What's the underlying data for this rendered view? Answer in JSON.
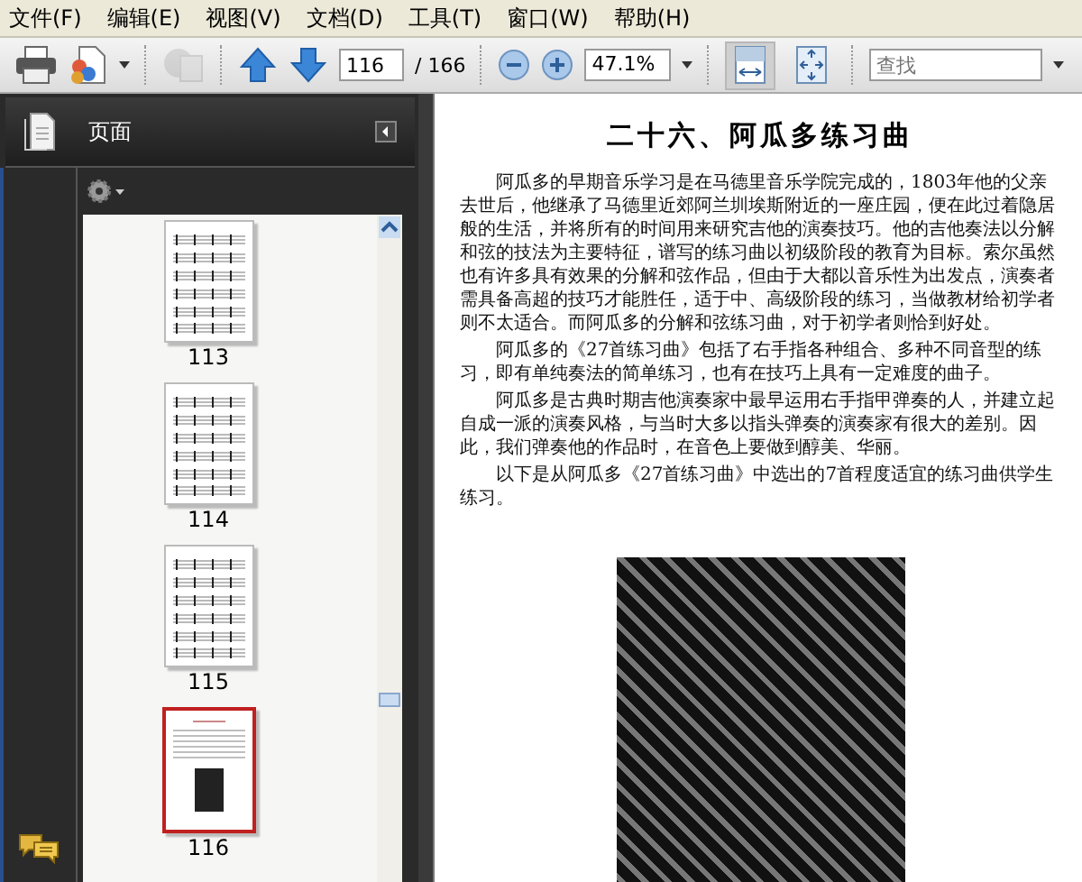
{
  "menu": [
    {
      "label": "文件(F)"
    },
    {
      "label": "编辑(E)"
    },
    {
      "label": "视图(V)"
    },
    {
      "label": "文档(D)"
    },
    {
      "label": "工具(T)"
    },
    {
      "label": "窗口(W)"
    },
    {
      "label": "帮助(H)"
    }
  ],
  "toolbar": {
    "share": {
      "disabled": true
    },
    "page_number": "116",
    "page_count": "/ 166",
    "zoom": "47.1%",
    "view_buttons": [
      {
        "kind": "fit-width",
        "selected": true
      },
      {
        "kind": "fit-page",
        "selected": false
      }
    ],
    "search": {
      "placeholder": "查找"
    }
  },
  "sidebar": {
    "title": "页面",
    "thumbnails": [
      {
        "label": "113",
        "kind": "music",
        "selected": false
      },
      {
        "label": "114",
        "kind": "music",
        "selected": false
      },
      {
        "label": "115",
        "kind": "music",
        "selected": false
      },
      {
        "label": "116",
        "kind": "text",
        "selected": true
      }
    ]
  },
  "document": {
    "title": "二十六、阿瓜多练习曲",
    "paragraphs": [
      "阿瓜多的早期音乐学习是在马德里音乐学院完成的，1803年他的父亲去世后，他继承了马德里近郊阿兰圳埃斯附近的一座庄园，便在此过着隐居般的生活，并将所有的时间用来研究吉他的演奏技巧。他的吉他奏法以分解和弦的技法为主要特征，谱写的练习曲以初级阶段的教育为目标。索尔虽然也有许多具有效果的分解和弦作品，但由于大都以音乐性为出发点，演奏者需具备高超的技巧才能胜任，适于中、高级阶段的练习，当做教材给初学者则不太适合。而阿瓜多的分解和弦练习曲，对于初学者则恰到好处。",
      "阿瓜多的《27首练习曲》包括了右手指各种组合、多种不同音型的练习，即有单纯奏法的简单练习，也有在技巧上具有一定难度的曲子。",
      "阿瓜多是古典时期吉他演奏家中最早运用右手指甲弹奏的人，并建立起自成一派的演奏风格，与当时大多以指头弹奏的演奏家有很大的差别。因此，我们弹奏他的作品时，在音色上要做到醇美、华丽。",
      "以下是从阿瓜多《27首练习曲》中选出的7首程度适宜的练习曲供学生练习。"
    ]
  }
}
